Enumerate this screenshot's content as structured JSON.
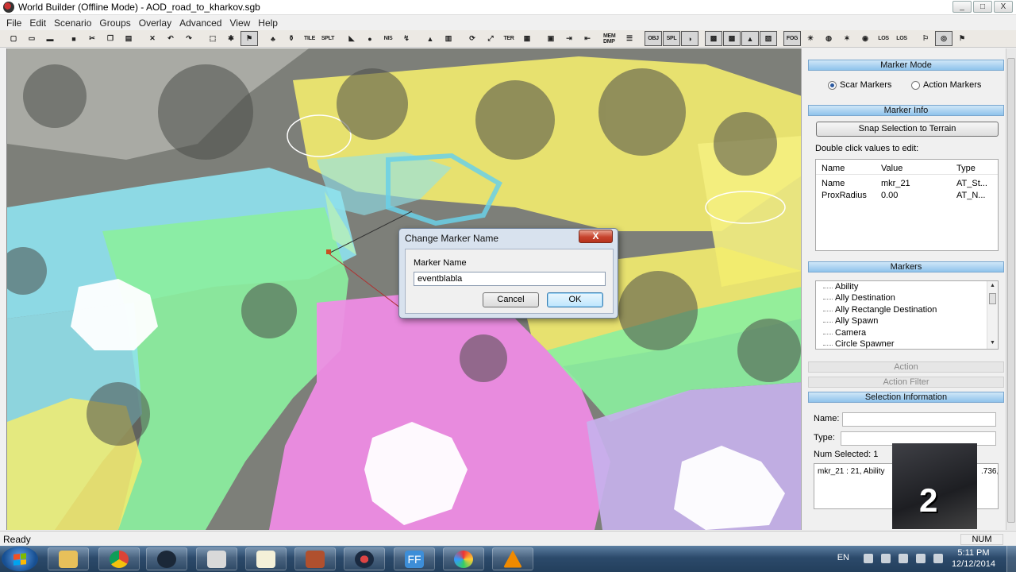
{
  "window": {
    "title": "World Builder (Offline Mode) - AOD_road_to_kharkov.sgb",
    "controls": [
      "_",
      "□",
      "X"
    ]
  },
  "menu": [
    "File",
    "Edit",
    "Scenario",
    "Groups",
    "Overlay",
    "Advanced",
    "View",
    "Help"
  ],
  "toolbar": {
    "text_buttons": [
      "TILE",
      "SPLT",
      "NIS",
      "TER",
      "MEM DMP",
      "OBJ",
      "SPL",
      "FOG",
      "LOS",
      "LOS"
    ]
  },
  "dialog": {
    "title": "Change Marker Name",
    "close": "X",
    "label": "Marker Name",
    "value": "eventblabla",
    "cancel": "Cancel",
    "ok": "OK"
  },
  "panel": {
    "marker_mode_header": "Marker Mode",
    "scar_markers": "Scar Markers",
    "action_markers": "Action Markers",
    "marker_info_header": "Marker Info",
    "snap_button": "Snap Selection to Terrain",
    "edit_hint": "Double click values to edit:",
    "grid": {
      "columns": [
        "Name",
        "Value",
        "Type"
      ],
      "rows": [
        [
          "Name",
          "mkr_21",
          "AT_St..."
        ],
        [
          "ProxRadius",
          "0.00",
          "AT_N..."
        ]
      ]
    },
    "markers_header": "Markers",
    "markers": [
      "Ability",
      "Ally Destination",
      "Ally Rectangle Destination",
      "Ally Spawn",
      "Camera",
      "Circle Spawner"
    ],
    "action_header": "Action",
    "action_filter_header": "Action Filter",
    "selection_header": "Selection Information",
    "name_label": "Name:",
    "type_label": "Type:",
    "num_selected": "Num Selected: 1",
    "selection_text": "mkr_21 : 21, Ability",
    "selection_text_tail": ".736,"
  },
  "webcam": {
    "number": "2"
  },
  "status": {
    "text": "Ready",
    "num": "NUM"
  },
  "taskbar": {
    "lang": "EN",
    "time": "5:11 PM",
    "date": "12/12/2014",
    "ff_label": "FF"
  },
  "colors": {
    "header_blue": "#8fc3ec",
    "overlay_yellow": "#f6f07a",
    "overlay_magenta": "#f08ce6",
    "overlay_cyan": "#90e4f0",
    "overlay_green": "#8ef0a0",
    "overlay_purple": "#c5b1ec"
  }
}
